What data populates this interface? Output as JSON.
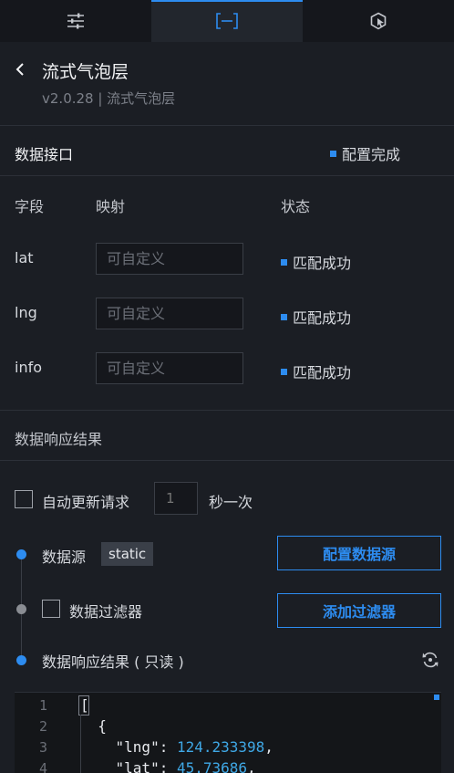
{
  "tabs": [
    {
      "icon": "sliders-icon",
      "active": false
    },
    {
      "icon": "bracket-data-icon",
      "active": true
    },
    {
      "icon": "interaction-icon",
      "active": false
    }
  ],
  "header": {
    "title": "流式气泡层",
    "version": "v2.0.28 | 流式气泡层"
  },
  "api": {
    "label": "数据接口",
    "status": "配置完成"
  },
  "columns": {
    "field": "字段",
    "mapping": "映射",
    "status": "状态"
  },
  "fields": [
    {
      "name": "lat",
      "placeholder": "可自定义",
      "status": "匹配成功"
    },
    {
      "name": "lng",
      "placeholder": "可自定义",
      "status": "匹配成功"
    },
    {
      "name": "info",
      "placeholder": "可自定义",
      "status": "匹配成功"
    }
  ],
  "response": {
    "title": "数据响应结果",
    "auto_update_label": "自动更新请求",
    "interval_value": "1",
    "interval_unit": "秒一次",
    "source_label": "数据源",
    "source_tag": "static",
    "config_source_button": "配置数据源",
    "filter_label": "数据过滤器",
    "add_filter_button": "添加过滤器",
    "result_label": "数据响应结果 ( 只读 )"
  },
  "code": {
    "line_numbers": [
      "1",
      "2",
      "3",
      "4"
    ],
    "lines": [
      {
        "text": "["
      },
      {
        "text": "  {"
      },
      {
        "key": "    \"lng\": ",
        "value": "124.233398",
        "suffix": ","
      },
      {
        "key": "    \"lat\": ",
        "value": "45.73686",
        "suffix": ","
      }
    ]
  },
  "colors": {
    "accent": "#2d8cf0",
    "background": "#1b1e24",
    "tab_bar": "#15171c",
    "code_number": "#3fa8e6"
  }
}
